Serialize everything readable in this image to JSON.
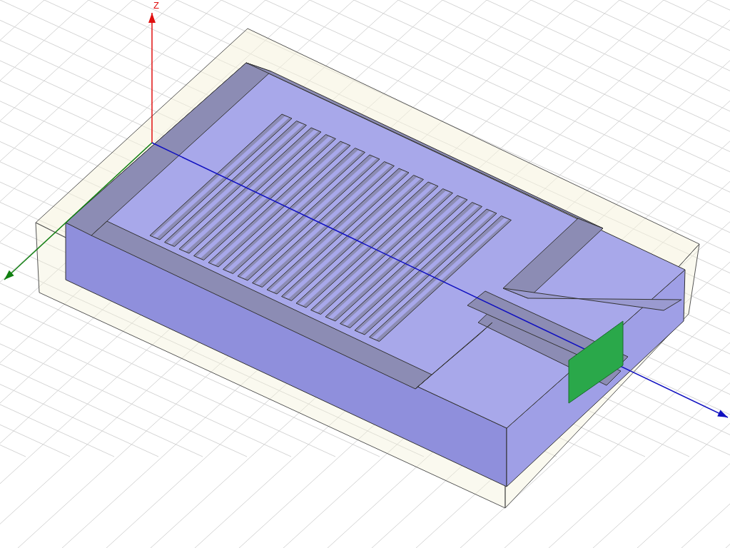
{
  "viewport": {
    "axis_labels": [
      {
        "kind": "z",
        "label": "Z"
      }
    ]
  }
}
